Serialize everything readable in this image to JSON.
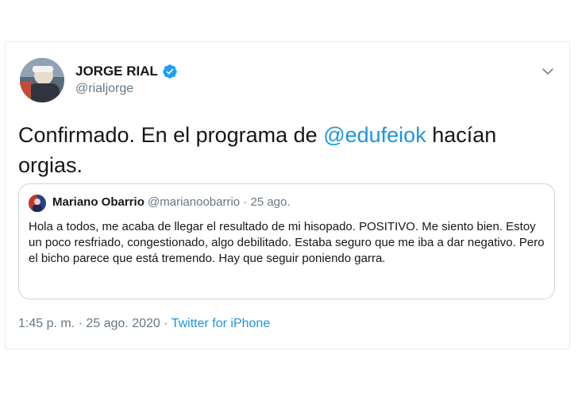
{
  "tweet": {
    "author_name": "JORGE RIAL",
    "author_handle": "@rialjorge",
    "text_before": "Confirmado. En el programa de ",
    "mention": "@edufeiok",
    "text_after": " hacían orgias.",
    "timestamp": "1:45 p. m. · 25 ago. 2020 · ",
    "source": "Twitter for iPhone"
  },
  "quoted": {
    "author_name": "Mariano Obarrio",
    "author_handle": "@marianoobarrio · 25 ago.",
    "text": "Hola a todos, me acaba de llegar el resultado de mi hisopado. POSITIVO. Me siento bien. Estoy un poco resfriado, congestionado, algo debilitado. Estaba seguro que me iba a dar negativo. Pero el bicho parece que está tremendo. Hay que seguir poniendo garra."
  },
  "icons": {
    "verified": "verified-badge-icon",
    "more": "chevron-down-icon"
  },
  "colors": {
    "accent": "#1b95e0",
    "muted": "#657786",
    "text": "#14171a",
    "border": "#ccd6dd"
  }
}
